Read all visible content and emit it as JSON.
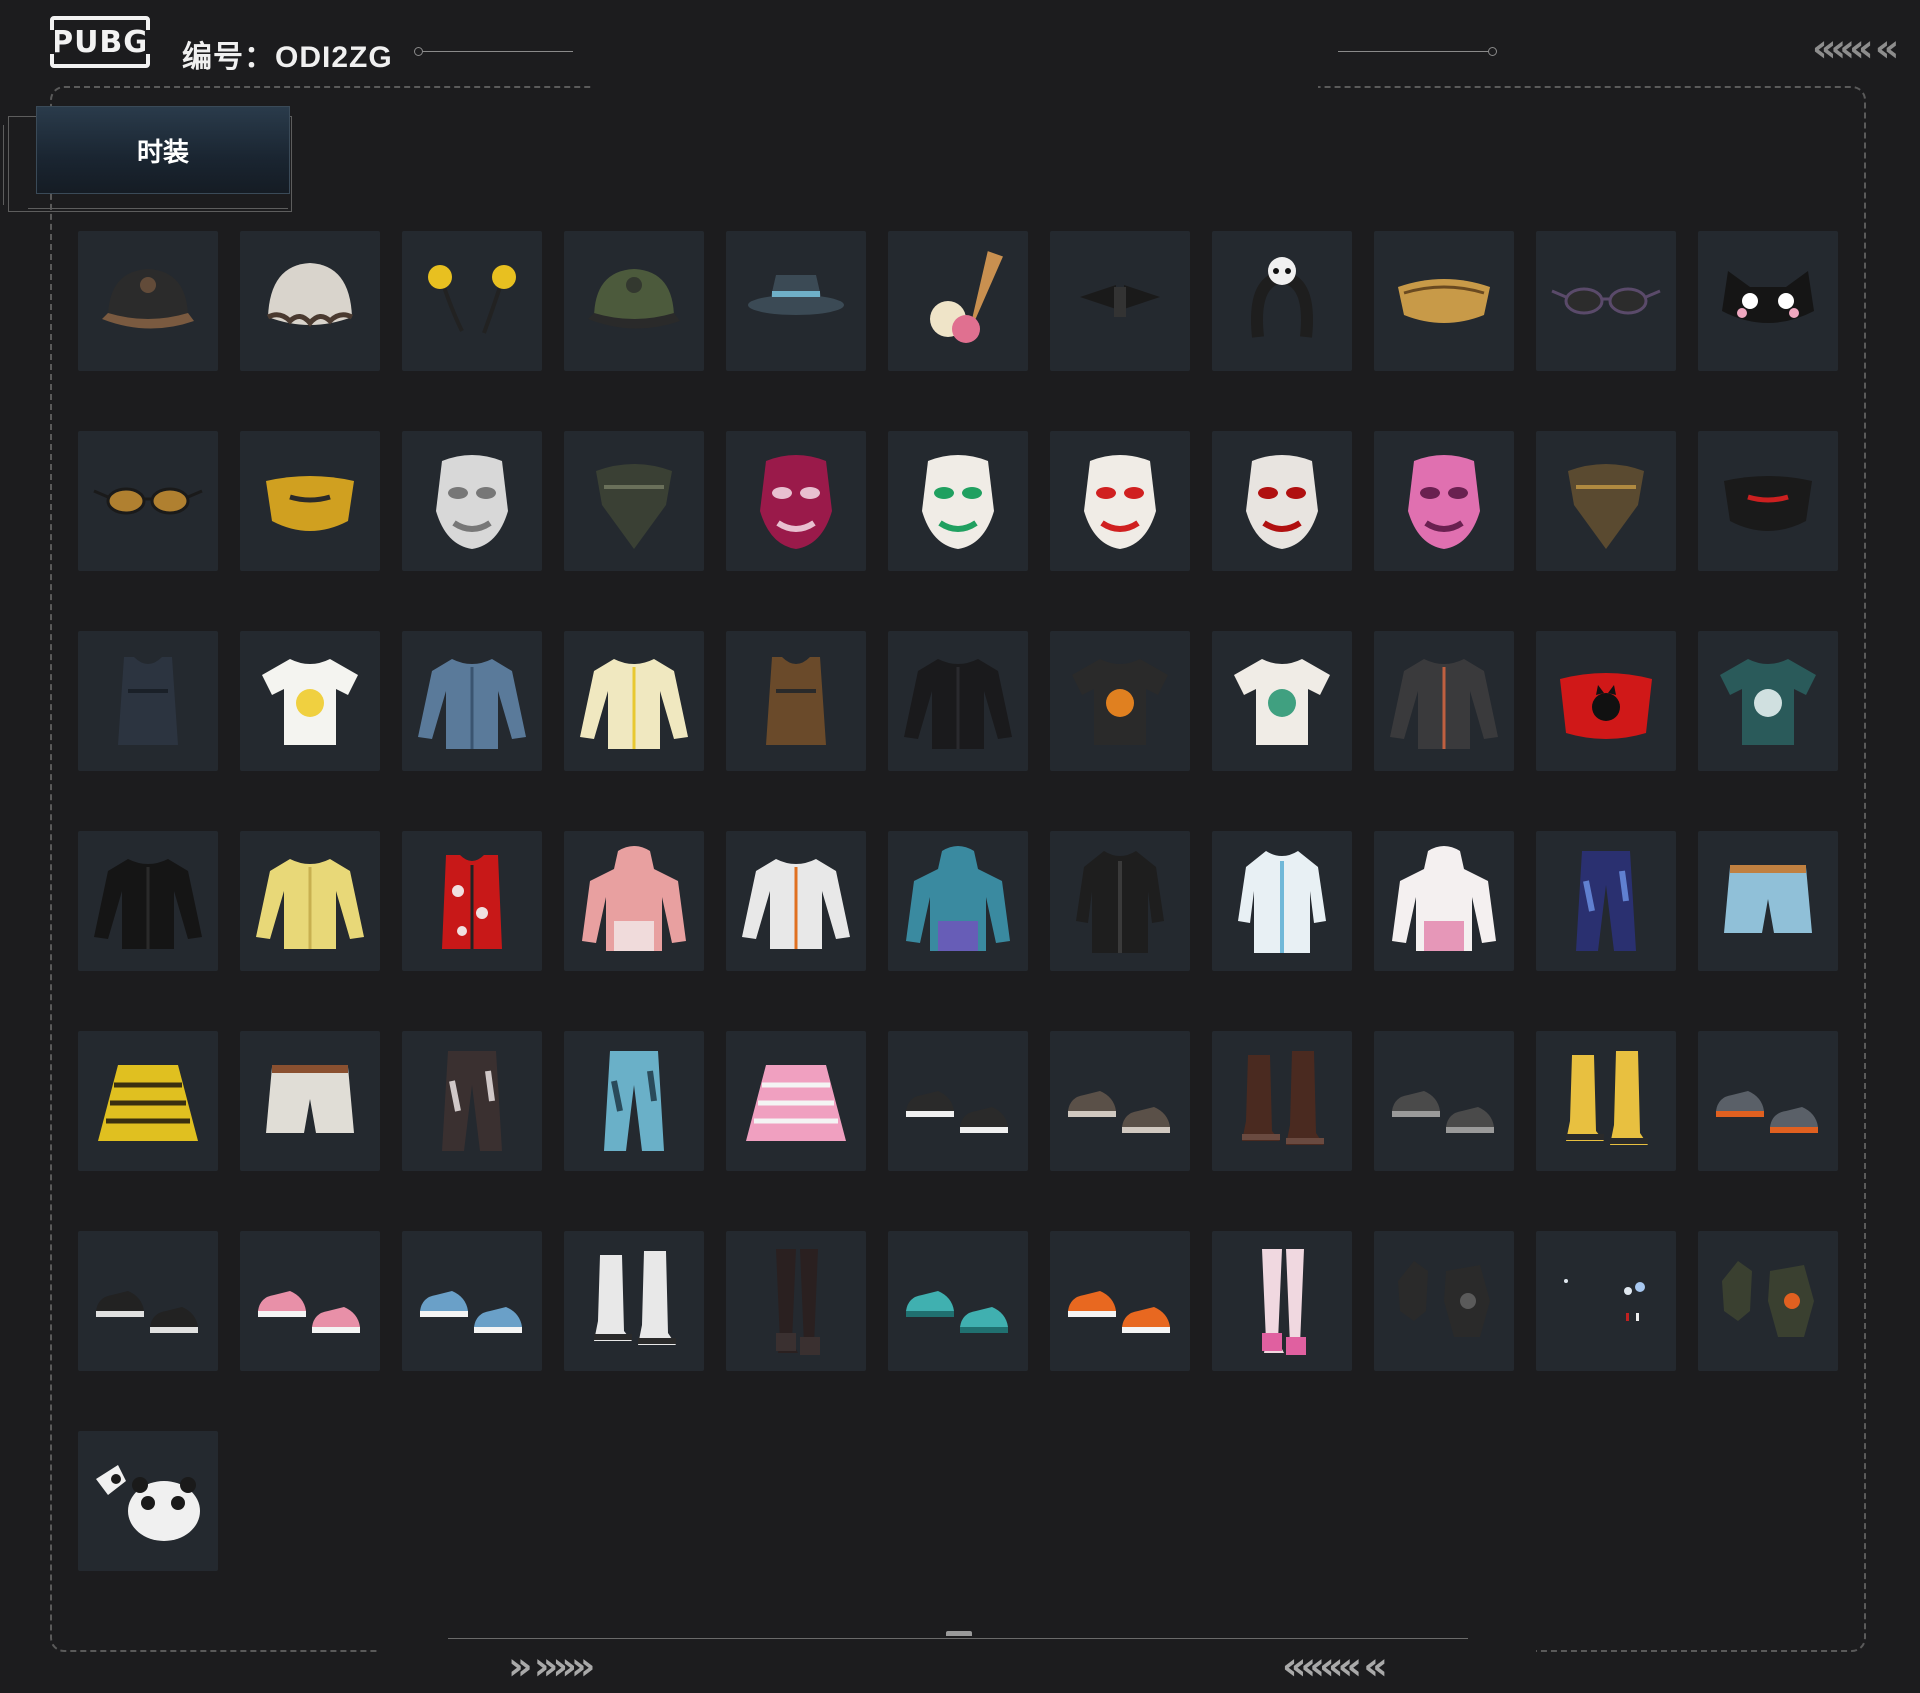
{
  "header": {
    "logo_text": "PUBG",
    "code_label": "编号：ODI2ZG",
    "nav_arrows_top": "«««  «"
  },
  "category_tab": {
    "label": "时装"
  },
  "footer": {
    "arrows_left": "» »»»",
    "arrows_right": "«««« «"
  },
  "colors": {
    "background": "#1c1c1e",
    "cell_background": "#24292f",
    "tab_gradient_top": "#2a3b4b",
    "frame_dash": "#5a5a5a"
  },
  "items": [
    {
      "name": "aviator-goggle-cap-icon",
      "icon": "cap",
      "color": "#2b2b2b",
      "accent": "#7a5a40"
    },
    {
      "name": "ruffled-bonnet-icon",
      "icon": "bonnet",
      "color": "#d9d4cc",
      "accent": "#4a3a30"
    },
    {
      "name": "pom-antenna-headband-icon",
      "icon": "antenna",
      "color": "#e8c020",
      "accent": "#222222"
    },
    {
      "name": "headset-cap-icon",
      "icon": "cap",
      "color": "#4c5a3c",
      "accent": "#2a2a2a"
    },
    {
      "name": "bucket-hat-icon",
      "icon": "bucket",
      "color": "#3b4a55",
      "accent": "#6fb0c8"
    },
    {
      "name": "ice-cream-cone-hat-icon",
      "icon": "cone",
      "color": "#c99050",
      "accent": "#e07090"
    },
    {
      "name": "black-bow-headband-icon",
      "icon": "bow",
      "color": "#1a1a1a",
      "accent": "#333333"
    },
    {
      "name": "panda-headband-icon",
      "icon": "headband",
      "color": "#1e1e1e",
      "accent": "#f0f0f0"
    },
    {
      "name": "gold-fanny-pack-icon",
      "icon": "pack",
      "color": "#c89a48",
      "accent": "#6a4a20"
    },
    {
      "name": "round-sunglasses-icon",
      "icon": "glasses",
      "color": "#2c2c2c",
      "accent": "#5a4a6a"
    },
    {
      "name": "cat-eye-mask-icon",
      "icon": "catmask",
      "color": "#151515",
      "accent": "#f0a8c0"
    },
    {
      "name": "gold-sport-glasses-icon",
      "icon": "glasses",
      "color": "#b08030",
      "accent": "#1a1a1a"
    },
    {
      "name": "gold-half-mask-icon",
      "icon": "halfmask",
      "color": "#d0a020",
      "accent": "#2a2a2a"
    },
    {
      "name": "silver-masquerade-mask-icon",
      "icon": "mask",
      "color": "#d8d8d8",
      "accent": "#777777"
    },
    {
      "name": "camo-face-cover-icon",
      "icon": "bandana",
      "color": "#3a4034",
      "accent": "#6a705a"
    },
    {
      "name": "magenta-stripe-mask-icon",
      "icon": "mask",
      "color": "#9a1a4a",
      "accent": "#e8c0d0"
    },
    {
      "name": "joker-mask-icon",
      "icon": "mask",
      "color": "#f0ece6",
      "accent": "#20a060"
    },
    {
      "name": "clown-mask-icon",
      "icon": "mask",
      "color": "#f0ece6",
      "accent": "#d02020"
    },
    {
      "name": "red-skull-mask-icon",
      "icon": "mask",
      "color": "#e8e4e0",
      "accent": "#b01010"
    },
    {
      "name": "pink-hippo-mask-icon",
      "icon": "mask",
      "color": "#e070b0",
      "accent": "#6a2050"
    },
    {
      "name": "patterned-scarf-icon",
      "icon": "bandana",
      "color": "#5a4a30",
      "accent": "#b08a40"
    },
    {
      "name": "black-face-mask-icon",
      "icon": "halfmask",
      "color": "#1a1a1a",
      "accent": "#cc2020"
    },
    {
      "name": "navy-tank-top-icon",
      "icon": "tank",
      "color": "#2c3440",
      "accent": "#1a2028"
    },
    {
      "name": "chick-raglan-tee-icon",
      "icon": "tee",
      "color": "#f4f4f0",
      "accent": "#f0d040"
    },
    {
      "name": "denim-shirt-icon",
      "icon": "longsleeve",
      "color": "#5a7a9a",
      "accent": "#3a5470"
    },
    {
      "name": "yellow-crop-sweater-icon",
      "icon": "longsleeve",
      "color": "#f0e8c0",
      "accent": "#e8c830"
    },
    {
      "name": "leopard-bandana-top-icon",
      "icon": "tank",
      "color": "#6a4a2a",
      "accent": "#2a2a2a"
    },
    {
      "name": "black-turtleneck-icon",
      "icon": "longsleeve",
      "color": "#1a1a1c",
      "accent": "#2a2a2e"
    },
    {
      "name": "black-graphic-tee-icon",
      "icon": "tee",
      "color": "#2a2a2a",
      "accent": "#e08020"
    },
    {
      "name": "white-print-tee-icon",
      "icon": "tee",
      "color": "#f0ece6",
      "accent": "#40a080"
    },
    {
      "name": "tattoo-sleeve-tee-icon",
      "icon": "longsleeve",
      "color": "#3a3a3c",
      "accent": "#c06040"
    },
    {
      "name": "red-cat-tube-top-icon",
      "icon": "tube",
      "color": "#d01818",
      "accent": "#111111"
    },
    {
      "name": "floral-shirt-icon",
      "icon": "tee",
      "color": "#2a5a5a",
      "accent": "#d0e0e0"
    },
    {
      "name": "black-jacket-icon",
      "icon": "longsleeve",
      "color": "#151515",
      "accent": "#2a2a2a"
    },
    {
      "name": "yellow-fluffy-sweater-icon",
      "icon": "longsleeve",
      "color": "#e8d878",
      "accent": "#c8b050"
    },
    {
      "name": "red-floral-vest-icon",
      "icon": "vest",
      "color": "#c81818",
      "accent": "#f0e0e0"
    },
    {
      "name": "pink-bunny-hoodie-icon",
      "icon": "hoodie",
      "color": "#e8a0a0",
      "accent": "#f4f4f4"
    },
    {
      "name": "orange-tactical-jacket-icon",
      "icon": "longsleeve",
      "color": "#e8e8e8",
      "accent": "#e07020"
    },
    {
      "name": "gradient-hoodie-icon",
      "icon": "hoodie",
      "color": "#3a8aa0",
      "accent": "#7a4ac0"
    },
    {
      "name": "black-coat-icon",
      "icon": "coat",
      "color": "#1e1e1e",
      "accent": "#3a3a3a"
    },
    {
      "name": "white-blue-coat-icon",
      "icon": "coat",
      "color": "#e8f0f4",
      "accent": "#70b8d8"
    },
    {
      "name": "pink-white-jacket-icon",
      "icon": "hoodie",
      "color": "#f4f0f0",
      "accent": "#e070a0"
    },
    {
      "name": "blue-print-pants-icon",
      "icon": "pants",
      "color": "#2a3070",
      "accent": "#6080d0"
    },
    {
      "name": "denim-shorts-icon",
      "icon": "shorts",
      "color": "#90c0d8",
      "accent": "#c08040"
    },
    {
      "name": "yellow-stripe-skirt-icon",
      "icon": "skirt",
      "color": "#e0c020",
      "accent": "#3a3010"
    },
    {
      "name": "white-shorts-icon",
      "icon": "shorts",
      "color": "#e0ddd6",
      "accent": "#8a5030"
    },
    {
      "name": "camo-cargo-pants-icon",
      "icon": "pants",
      "color": "#3a3030",
      "accent": "#d0c8c8"
    },
    {
      "name": "light-jeans-icon",
      "icon": "pants",
      "color": "#6ab0c8",
      "accent": "#2a4a5a"
    },
    {
      "name": "pink-pleated-skirt-icon",
      "icon": "skirt",
      "color": "#f0a0c0",
      "accent": "#f4f4f4"
    },
    {
      "name": "sock-sandals-icon",
      "icon": "shoes",
      "color": "#2a2a2a",
      "accent": "#f0f0f0"
    },
    {
      "name": "gray-sneakers-icon",
      "icon": "shoes",
      "color": "#5a5048",
      "accent": "#d0c8c0"
    },
    {
      "name": "brown-tall-boots-icon",
      "icon": "boots",
      "color": "#4a2a20",
      "accent": "#6a4a40"
    },
    {
      "name": "gray-paw-shoes-icon",
      "icon": "shoes",
      "color": "#4a4a4a",
      "accent": "#9a9a9a"
    },
    {
      "name": "yellow-leg-warmers-icon",
      "icon": "boots",
      "color": "#e8c040",
      "accent": "#2a2a2a"
    },
    {
      "name": "gray-orange-sneakers-icon",
      "icon": "shoes",
      "color": "#5a6068",
      "accent": "#e06020"
    },
    {
      "name": "black-skate-shoes-icon",
      "icon": "shoes",
      "color": "#222222",
      "accent": "#e0e0e0"
    },
    {
      "name": "pink-shark-slippers-icon",
      "icon": "shoes",
      "color": "#e890a8",
      "accent": "#f4f4f4"
    },
    {
      "name": "blue-shark-slippers-icon",
      "icon": "shoes",
      "color": "#6aa0c8",
      "accent": "#f4f4f4"
    },
    {
      "name": "white-combat-boots-icon",
      "icon": "boots",
      "color": "#e8e8e8",
      "accent": "#2a2a2a"
    },
    {
      "name": "black-thigh-stockings-icon",
      "icon": "stockings",
      "color": "#2a2020",
      "accent": "#3a3030"
    },
    {
      "name": "teal-clogs-icon",
      "icon": "shoes",
      "color": "#40b0b0",
      "accent": "#207070"
    },
    {
      "name": "orange-high-tops-icon",
      "icon": "shoes",
      "color": "#e86820",
      "accent": "#f4f4f4"
    },
    {
      "name": "pink-fishnet-boots-icon",
      "icon": "stockings",
      "color": "#f0d8e0",
      "accent": "#e060a0"
    },
    {
      "name": "black-fingerless-gloves-icon",
      "icon": "gloves",
      "color": "#2a2a2a",
      "accent": "#5a5a5a"
    },
    {
      "name": "tiny-ear-accessories-icon",
      "icon": "tiny",
      "color": "#e0e8f0",
      "accent": "#c02020"
    },
    {
      "name": "camo-tactical-gloves-icon",
      "icon": "gloves",
      "color": "#3a4030",
      "accent": "#e06020"
    },
    {
      "name": "panda-accessory-icon",
      "icon": "panda",
      "color": "#f0f0f0",
      "accent": "#1a1a1a"
    }
  ]
}
